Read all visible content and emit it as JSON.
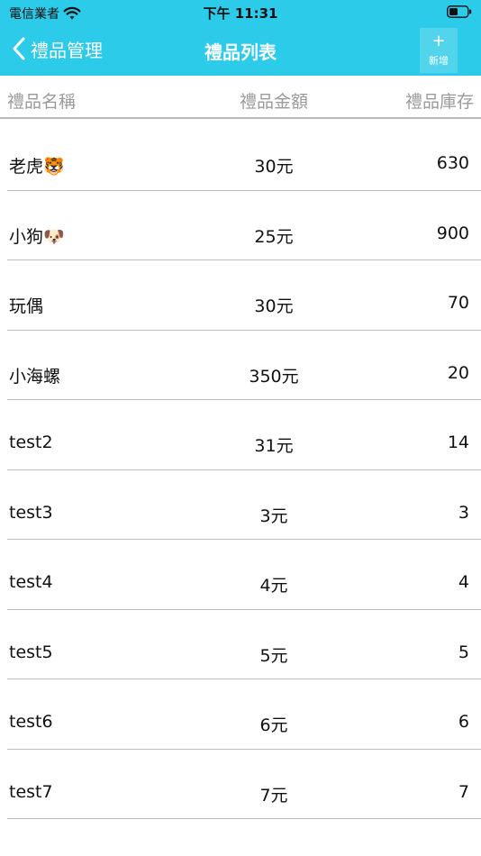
{
  "status_bar": {
    "carrier": "電信業者",
    "time": "下午 11:31"
  },
  "nav": {
    "back_label": "禮品管理",
    "title": "禮品列表",
    "add_plus": "+",
    "add_label": "新增"
  },
  "table": {
    "headers": {
      "name": "禮品名稱",
      "price": "禮品金額",
      "stock": "禮品庫存"
    },
    "rows": [
      {
        "name": "老虎🐯",
        "price": "30元",
        "stock": "630"
      },
      {
        "name": "小狗🐶",
        "price": "25元",
        "stock": "900"
      },
      {
        "name": "玩偶",
        "price": "30元",
        "stock": "70"
      },
      {
        "name": "小海螺",
        "price": "350元",
        "stock": "20"
      },
      {
        "name": "test2",
        "price": "31元",
        "stock": "14"
      },
      {
        "name": "test3",
        "price": "3元",
        "stock": "3"
      },
      {
        "name": "test4",
        "price": "4元",
        "stock": "4"
      },
      {
        "name": "test5",
        "price": "5元",
        "stock": "5"
      },
      {
        "name": "test6",
        "price": "6元",
        "stock": "6"
      },
      {
        "name": "test7",
        "price": "7元",
        "stock": "7"
      }
    ]
  },
  "colors": {
    "nav_background": "#2ccbea",
    "header_text": "#9a9a9a",
    "divider": "#bdbdbd"
  },
  "icons": [
    "wifi-icon",
    "battery-icon",
    "chevron-left-icon"
  ]
}
